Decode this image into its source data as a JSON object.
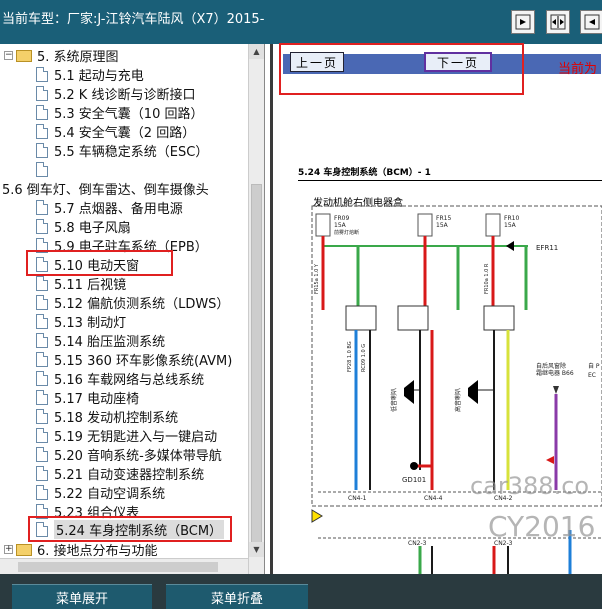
{
  "header": {
    "title": "当前车型：厂家:J-江铃汽车陆风（X7）2015-"
  },
  "tree": {
    "items": [
      {
        "label": "5. 系统原理图",
        "kind": "folder"
      },
      {
        "label": "5.1 起动与充电",
        "kind": "doc"
      },
      {
        "label": "5.2 K 线诊断与诊断接口",
        "kind": "doc"
      },
      {
        "label": "5.3 安全气囊（10 回路）",
        "kind": "doc"
      },
      {
        "label": "5.4 安全气囊（2 回路）",
        "kind": "doc"
      },
      {
        "label": "5.5 车辆稳定系统（ESC）",
        "kind": "doc"
      },
      {
        "label": "",
        "kind": "doc"
      },
      {
        "label": "5.6 倒车灯、倒车雷达、倒车摄像头",
        "kind": "text"
      },
      {
        "label": "5.7 点烟器、备用电源",
        "kind": "doc"
      },
      {
        "label": "5.8 电子风扇",
        "kind": "doc"
      },
      {
        "label": "5.9 电子驻车系统（EPB）",
        "kind": "doc"
      },
      {
        "label": "5.10 电动天窗",
        "kind": "doc"
      },
      {
        "label": "5.11 后视镜",
        "kind": "doc"
      },
      {
        "label": "5.12 偏航侦测系统（LDWS）",
        "kind": "doc"
      },
      {
        "label": "5.13 制动灯",
        "kind": "doc"
      },
      {
        "label": "5.14 胎压监测系统",
        "kind": "doc"
      },
      {
        "label": "5.15 360 环车影像系统(AVM)",
        "kind": "doc"
      },
      {
        "label": "5.16 车载网络与总线系统",
        "kind": "doc"
      },
      {
        "label": "5.17 电动座椅",
        "kind": "doc"
      },
      {
        "label": "5.18 发动机控制系统",
        "kind": "doc"
      },
      {
        "label": "5.19 无钥匙进入与一键启动",
        "kind": "doc"
      },
      {
        "label": "5.20 音响系统-多媒体带导航",
        "kind": "doc"
      },
      {
        "label": "5.21 自动变速器控制系统",
        "kind": "doc"
      },
      {
        "label": "5.22 自动空调系统",
        "kind": "doc"
      },
      {
        "label": "5.23 组合仪表",
        "kind": "doc"
      },
      {
        "label": "5.24 车身控制系统（BCM）",
        "kind": "doc"
      },
      {
        "label": "6. 接地点分布与功能",
        "kind": "folder"
      }
    ]
  },
  "nav": {
    "prev_label": "上一页",
    "next_label": "下一页",
    "current_label": "当前为"
  },
  "diagram": {
    "title": "5.24 车身控制系统（BCM）- 1",
    "fusebox_label": "发动机舱右侧电器盒",
    "fuses": [
      {
        "name": "FR09",
        "rating": "15A"
      },
      {
        "name": "FR15",
        "rating": "15A"
      },
      {
        "name": "FR10",
        "rating": "15A"
      }
    ],
    "fuse_desc": "前雾灯熔断",
    "ground_ref": "EFR11",
    "ground_point": "GD101",
    "horn_low": "低音喇叭",
    "horn_high": "高音喇叭",
    "connectors": [
      "CN4-1",
      "CN4-4",
      "CN4-2",
      "CN2-3",
      "CN2-3"
    ],
    "wire_codes": [
      "FP28 1.0 BG",
      "RC09 1.0 G",
      "FR15a 1.0 Y",
      "FR10a 1.0 R"
    ],
    "right_labels": [
      "自后风窗除",
      "霜继电器 B66",
      "自 P",
      "EC"
    ]
  },
  "watermarks": [
    "car388.co",
    "CY2016"
  ],
  "bottom": {
    "expand_label": "菜单展开",
    "collapse_label": "菜单折叠"
  },
  "colors": {
    "topbar": "#1a5f78",
    "highlight": "#e02020",
    "wire_blue": "#1e7fd8",
    "wire_red": "#d81818",
    "wire_green": "#3aa84a",
    "wire_black": "#1a1a1a"
  }
}
